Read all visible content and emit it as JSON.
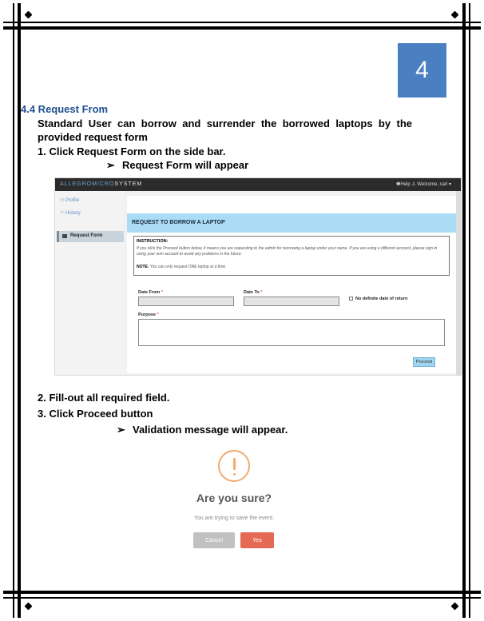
{
  "page": {
    "number": "4",
    "section_title": "4.4 Request From",
    "intro": "Standard User can borrow and surrender the borrowed laptops by the provided request form",
    "step1": "1. Click Request Form on the side bar.",
    "bullet1": "Request Form will appear",
    "step2": "2. Fill-out all required field.",
    "step3": "3. Click Proceed button",
    "bullet2": "Validation message will appear.",
    "bullet_symbol": "➢"
  },
  "screenshot": {
    "brand_a": "ALLEGROMICRO",
    "brand_b": "SYSTEM",
    "help": "Help",
    "welcome": "Welcome, carl ▾",
    "sidebar": {
      "profile": "Profile",
      "history": "History",
      "request_form": "Request Form"
    },
    "header": "REQUEST TO BORROW A LAPTOP",
    "instruction_title": "INSTRUCTION:",
    "instruction_body": "If you click the Proceed button below, it means you are requesting to the admin for borrowing a laptop under your name. If you are using a different account, please sign in using your own account to avoid any problems in the future.",
    "note_label": "NOTE:",
    "note_body": "You can only request ONE laptop at a time.",
    "date_from_label": "Date From",
    "date_to_label": "Date To",
    "required_mark": "*",
    "no_return_label": "No definite date of return",
    "purpose_label": "Purpose",
    "proceed": "Proceed"
  },
  "dialog": {
    "title": "Are you sure?",
    "text": "You are trying to save the event.",
    "cancel": "Cancel",
    "yes": "Yes",
    "icon": "exclamation-circle-icon",
    "accent_color": "#f0ab6e"
  },
  "colors": {
    "page_badge": "#4a7fc1",
    "section_title": "#1f4f8f",
    "header_band": "#aadcf5",
    "yes_button": "#e56a56",
    "cancel_button": "#c1c1c1"
  }
}
